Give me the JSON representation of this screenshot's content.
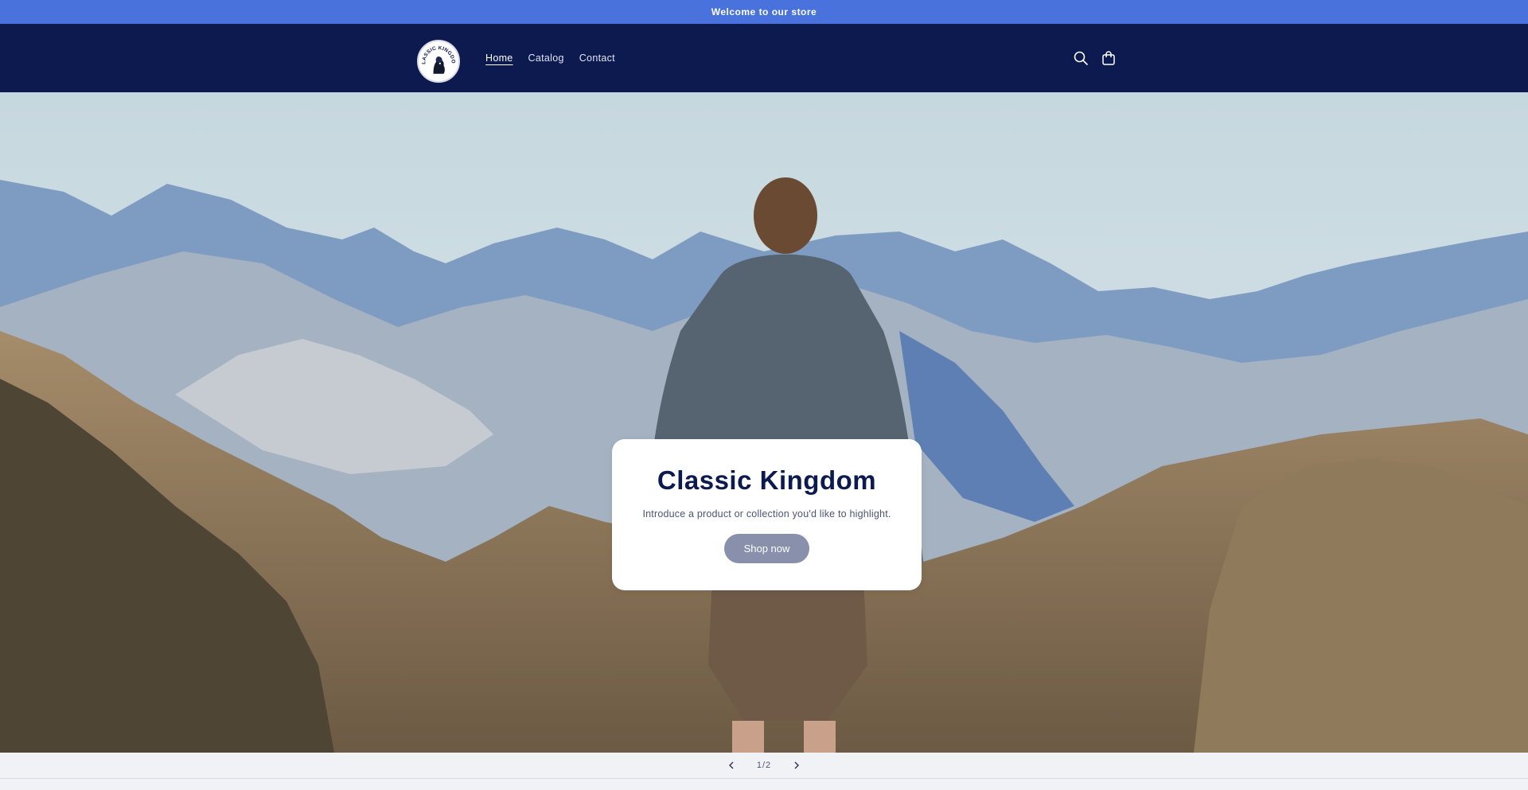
{
  "announcement": {
    "text": "Welcome to our store"
  },
  "header": {
    "logo_text": "CLASSIC KINGDOM",
    "nav": [
      {
        "label": "Home",
        "active": true
      },
      {
        "label": "Catalog",
        "active": false
      },
      {
        "label": "Contact",
        "active": false
      }
    ],
    "icons": {
      "search": "search-icon",
      "cart": "cart-icon"
    }
  },
  "hero": {
    "title": "Classic Kingdom",
    "subtitle": "Introduce a product or collection you'd like to highlight.",
    "button_label": "Shop now"
  },
  "slider": {
    "counter": "1/2",
    "prev_icon": "chevron-left-icon",
    "next_icon": "chevron-right-icon"
  },
  "colors": {
    "announcement_bg": "#4a72dd",
    "header_bg": "#0c1a4f",
    "button_bg": "#8890ac",
    "title": "#0c1a4f"
  }
}
